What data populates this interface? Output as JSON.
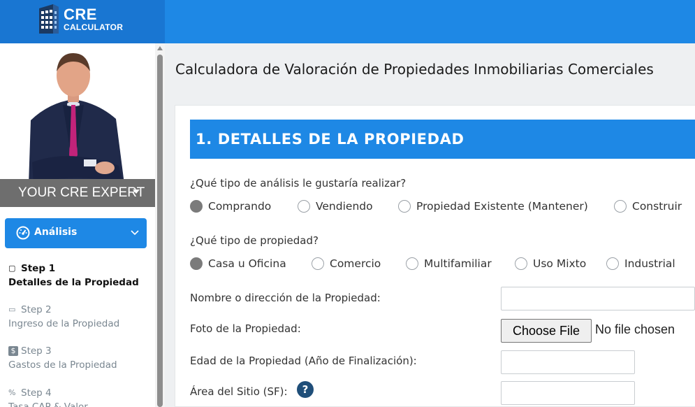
{
  "brand": {
    "line1": "CRE",
    "line2": "CALCULATOR"
  },
  "sidebar": {
    "expert_caption": "YOUR CRE EXPERT",
    "section_label": "Análisis",
    "steps": [
      {
        "step": "Step 1",
        "desc": "Detalles de la Propiedad",
        "icon": "comment-icon",
        "glyph": "▢"
      },
      {
        "step": "Step 2",
        "desc": "Ingreso de la Propiedad",
        "icon": "money-icon",
        "glyph": "▭"
      },
      {
        "step": "Step 3",
        "desc": "Gastos de la Propiedad",
        "icon": "dollar-icon",
        "glyph": "$"
      },
      {
        "step": "Step 4",
        "desc": "Tasa CAP & Valor",
        "icon": "percent-icon",
        "glyph": "%"
      }
    ]
  },
  "page": {
    "title": "Calculadora de Valoración de Propiedades Inmobiliarias Comerciales",
    "section_title": "1. DETALLES DE LA PROPIEDAD"
  },
  "form": {
    "analysis_question": "¿Qué tipo de análisis le gustaría realizar?",
    "analysis_options": [
      "Comprando",
      "Vendiendo",
      "Propiedad Existente (Mantener)",
      "Construir"
    ],
    "analysis_selected": "Comprando",
    "property_question": "¿Qué tipo de propiedad?",
    "property_options": [
      "Casa u Oficina",
      "Comercio",
      "Multifamiliar",
      "Uso Mixto",
      "Industrial"
    ],
    "property_selected": "Casa u Oficina",
    "name_label": "Nombre o dirección de la Propiedad:",
    "name_value": "",
    "photo_label": "Foto de la Propiedad:",
    "file_button": "Choose File",
    "file_status": "No file chosen",
    "age_label": "Edad de la Propiedad (Año de Finalización):",
    "age_value": "",
    "area_label": "Área del Sitio (SF):",
    "area_value": "",
    "help_glyph": "?"
  },
  "colors": {
    "primary": "#1e88e5",
    "header_dark": "#1976d2",
    "help": "#1f4e79"
  }
}
